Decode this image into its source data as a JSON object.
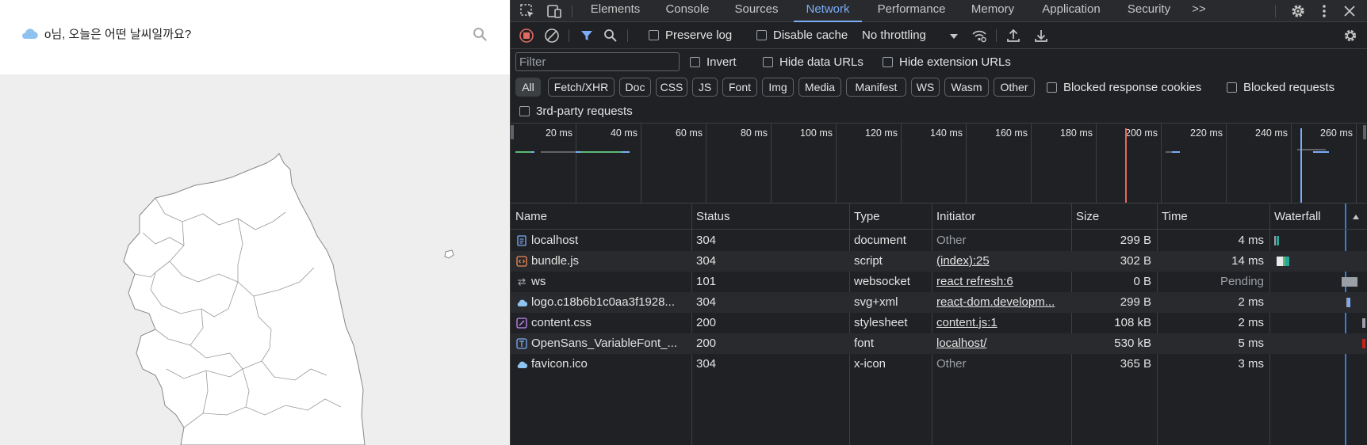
{
  "app": {
    "title": "님, 오늘은 어떤 날씨일까요?",
    "title_prefix_glyph": "o",
    "icons": {
      "logo": "cloud-icon",
      "search": "search-icon"
    }
  },
  "devtools": {
    "tabs": [
      "Elements",
      "Console",
      "Sources",
      "Network",
      "Performance",
      "Memory",
      "Application",
      "Security"
    ],
    "active_tab": "Network",
    "more_tabs_label": ">>",
    "toolbar": {
      "preserve_log": "Preserve log",
      "disable_cache": "Disable cache",
      "throttling": "No throttling"
    },
    "filter": {
      "placeholder": "Filter",
      "invert": "Invert",
      "hide_data_urls": "Hide data URLs",
      "hide_extension_urls": "Hide extension URLs",
      "types": [
        "All",
        "Fetch/XHR",
        "Doc",
        "CSS",
        "JS",
        "Font",
        "Img",
        "Media",
        "Manifest",
        "WS",
        "Wasm",
        "Other"
      ],
      "active_type": "All",
      "blocked_response_cookies": "Blocked response cookies",
      "blocked_requests": "Blocked requests",
      "third_party": "3rd-party requests"
    },
    "overview": {
      "ticks": [
        "20 ms",
        "40 ms",
        "60 ms",
        "80 ms",
        "100 ms",
        "120 ms",
        "140 ms",
        "160 ms",
        "180 ms",
        "200 ms",
        "220 ms",
        "240 ms",
        "260 ms"
      ]
    },
    "table": {
      "columns": [
        "Name",
        "Status",
        "Type",
        "Initiator",
        "Size",
        "Time",
        "Waterfall"
      ],
      "rows": [
        {
          "name": "localhost",
          "status": "304",
          "type": "document",
          "initiator": "Other",
          "size": "299 B",
          "time": "4 ms",
          "icon": "document-icon",
          "initiator_link": false,
          "pending": false
        },
        {
          "name": "bundle.js",
          "status": "304",
          "type": "script",
          "initiator": "(index):25",
          "size": "302 B",
          "time": "14 ms",
          "icon": "script-icon",
          "initiator_link": true,
          "pending": false
        },
        {
          "name": "ws",
          "status": "101",
          "type": "websocket",
          "initiator": "react refresh:6",
          "size": "0 B",
          "time": "Pending",
          "icon": "websocket-icon",
          "initiator_link": true,
          "pending": true
        },
        {
          "name": "logo.c18b6b1c0aa3f1928...",
          "status": "304",
          "type": "svg+xml",
          "initiator": "react-dom.developm...",
          "size": "299 B",
          "time": "2 ms",
          "icon": "image-icon",
          "initiator_link": true,
          "pending": false
        },
        {
          "name": "content.css",
          "status": "200",
          "type": "stylesheet",
          "initiator": "content.js:1",
          "size": "108 kB",
          "time": "2 ms",
          "icon": "stylesheet-icon",
          "initiator_link": true,
          "pending": false
        },
        {
          "name": "OpenSans_VariableFont_...",
          "status": "200",
          "type": "font",
          "initiator": "localhost/",
          "size": "530 kB",
          "time": "5 ms",
          "icon": "font-icon",
          "initiator_link": true,
          "pending": false
        },
        {
          "name": "favicon.ico",
          "status": "304",
          "type": "x-icon",
          "initiator": "Other",
          "size": "365 B",
          "time": "3 ms",
          "icon": "image-icon",
          "initiator_link": false,
          "pending": false
        }
      ]
    },
    "colors": {
      "accent": "#7cacf8",
      "record": "#e46962",
      "panel": "#202124"
    }
  }
}
